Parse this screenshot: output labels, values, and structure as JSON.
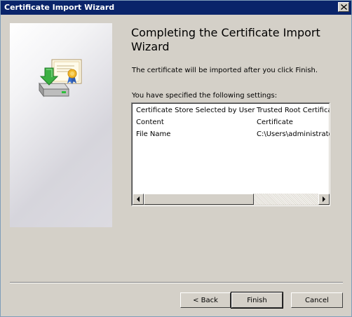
{
  "window": {
    "title": "Certificate Import Wizard"
  },
  "content": {
    "heading": "Completing the Certificate Import Wizard",
    "description": "The certificate will be imported after you click Finish.",
    "settings_label": "You have specified the following settings:",
    "settings": [
      {
        "key": "Certificate Store Selected by User",
        "value": "Trusted Root Certificat"
      },
      {
        "key": "Content",
        "value": "Certificate"
      },
      {
        "key": "File Name",
        "value": "C:\\Users\\administrato"
      }
    ]
  },
  "buttons": {
    "back": "< Back",
    "finish": "Finish",
    "cancel": "Cancel"
  },
  "icons": {
    "close": "close-icon",
    "wizard": "certificate-import-icon",
    "scroll_left": "scroll-left-arrow-icon",
    "scroll_right": "scroll-right-arrow-icon"
  },
  "colors": {
    "titlebar": "#0a246a",
    "window_bg": "#d4d0c8"
  }
}
